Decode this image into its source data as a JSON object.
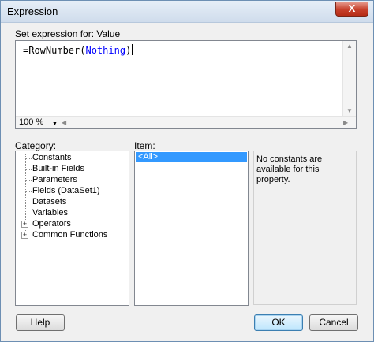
{
  "window": {
    "title": "Expression",
    "close_label": "X"
  },
  "expression": {
    "label": "Set expression for: Value",
    "prefix": "=RowNumber(",
    "keyword": "Nothing",
    "suffix": ")",
    "zoom": "100 %"
  },
  "category": {
    "label": "Category:",
    "items": [
      {
        "label": "Constants",
        "expandable": false
      },
      {
        "label": "Built-in Fields",
        "expandable": false
      },
      {
        "label": "Parameters",
        "expandable": false
      },
      {
        "label": "Fields (DataSet1)",
        "expandable": false
      },
      {
        "label": "Datasets",
        "expandable": false
      },
      {
        "label": "Variables",
        "expandable": false
      },
      {
        "label": "Operators",
        "expandable": true
      },
      {
        "label": "Common Functions",
        "expandable": true
      }
    ]
  },
  "item": {
    "label": "Item:",
    "selected": "<All>"
  },
  "description": {
    "text": "No constants are available for this property."
  },
  "buttons": {
    "help": "Help",
    "ok": "OK",
    "cancel": "Cancel"
  },
  "colors": {
    "keyword": "#0000ff",
    "selection": "#3399ff",
    "close": "#c7412c"
  }
}
